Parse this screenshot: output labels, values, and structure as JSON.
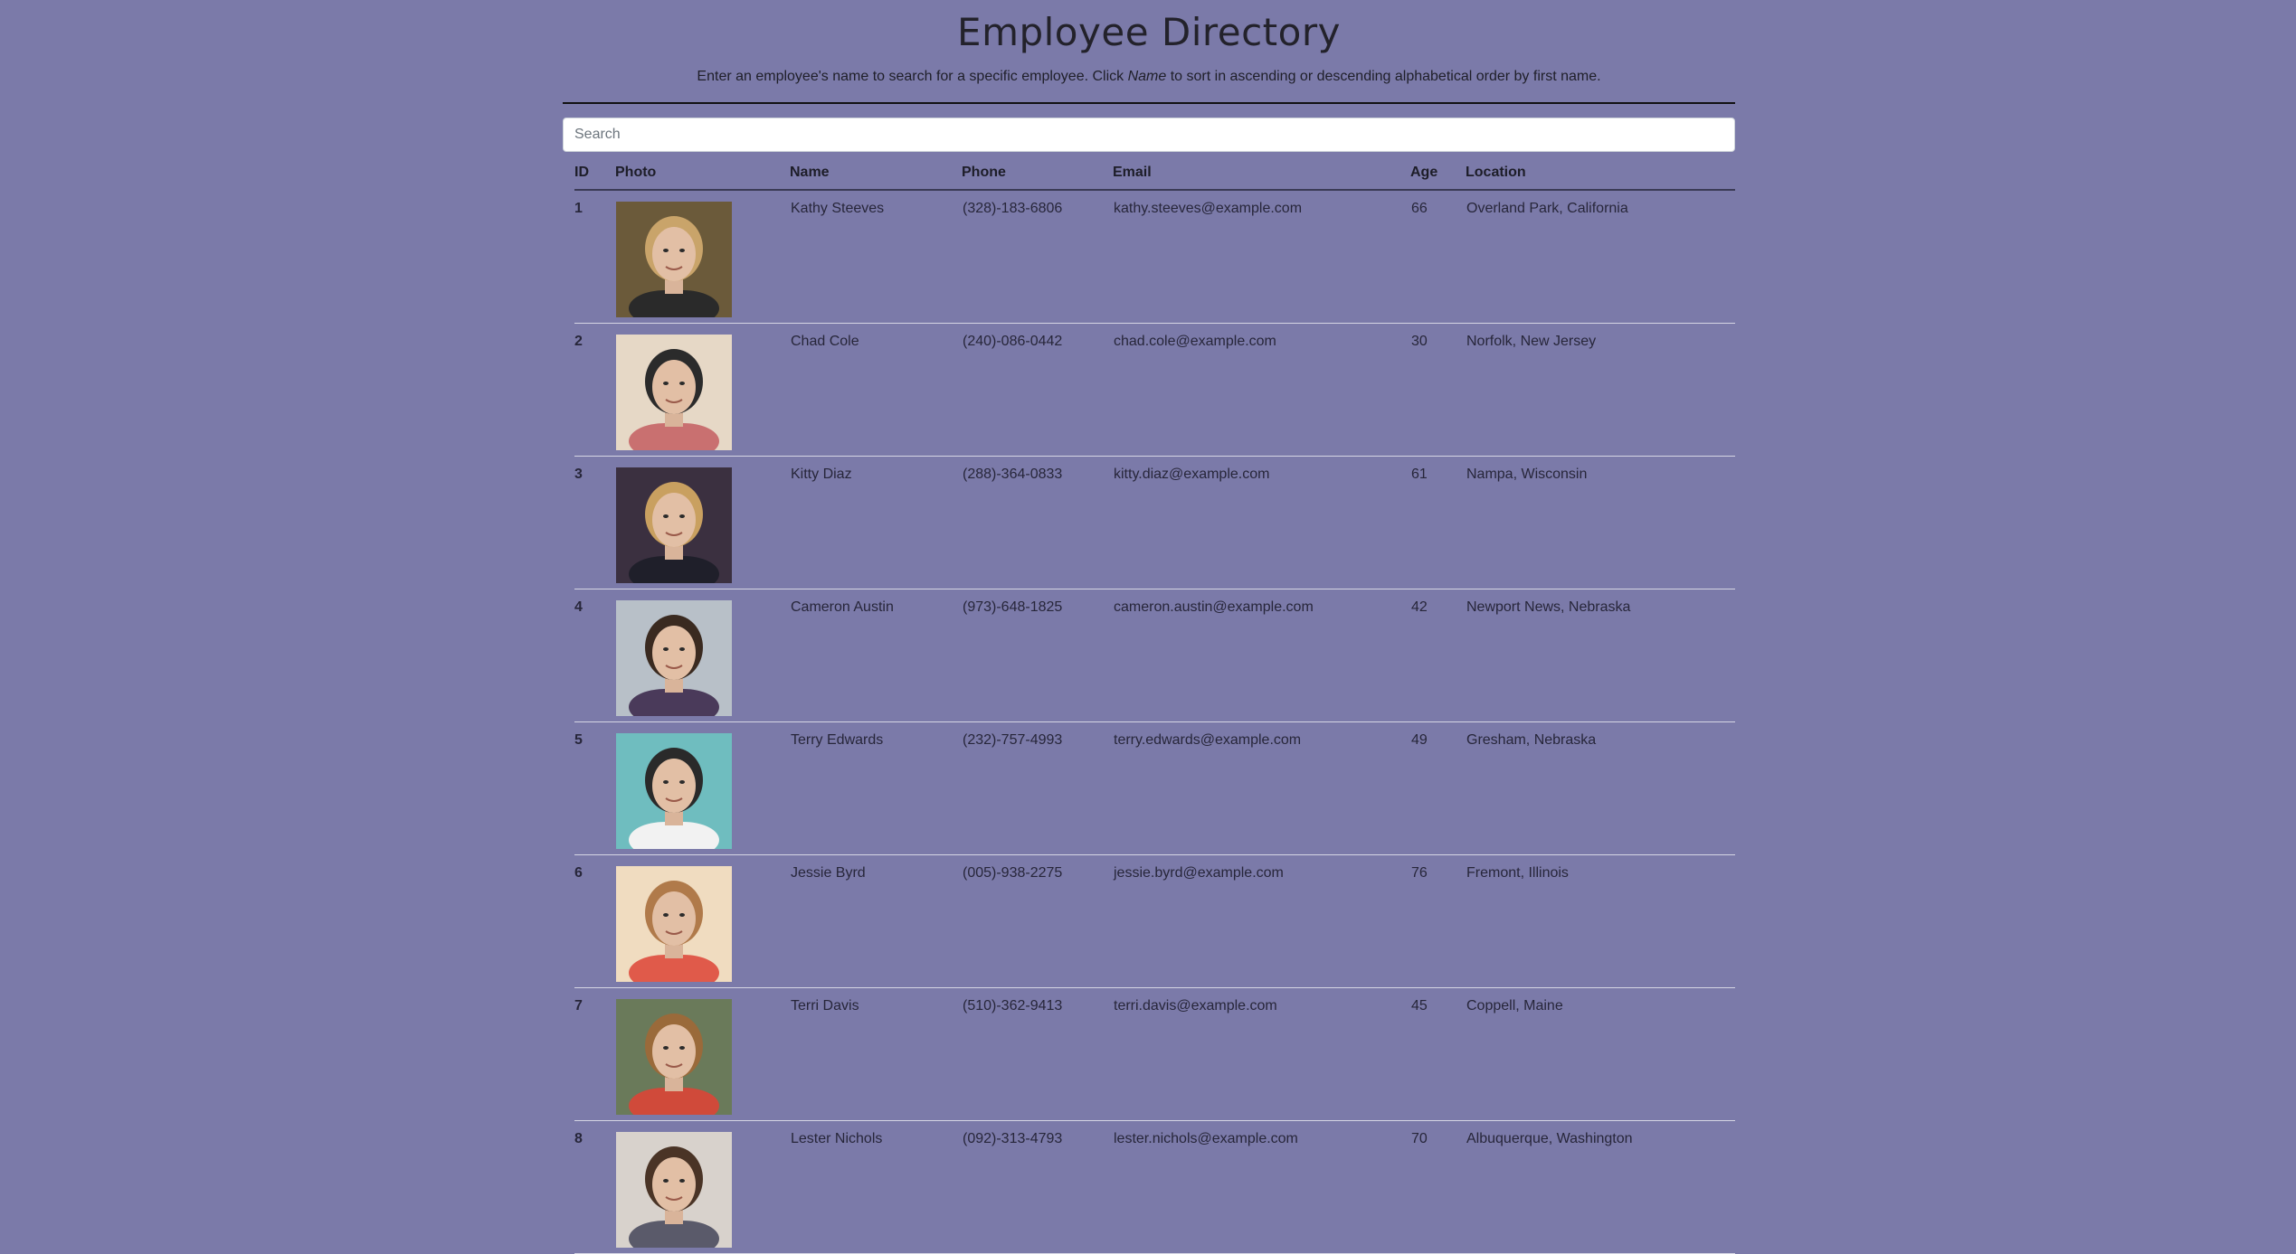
{
  "header": {
    "title": "Employee Directory",
    "subtitle_before": "Enter an employee's name to search for a specific employee. Click ",
    "subtitle_em": "Name",
    "subtitle_after": " to sort in ascending or descending alphabetical order by first name."
  },
  "search": {
    "placeholder": "Search",
    "value": ""
  },
  "table": {
    "columns": [
      "ID",
      "Photo",
      "Name",
      "Phone",
      "Email",
      "Age",
      "Location"
    ],
    "rows": [
      {
        "id": "1",
        "photo_icon": "employee-photo",
        "name": "Kathy Steeves",
        "phone": "(328)-183-6806",
        "email": "kathy.steeves@example.com",
        "age": "66",
        "location": "Overland Park, California"
      },
      {
        "id": "2",
        "photo_icon": "employee-photo",
        "name": "Chad Cole",
        "phone": "(240)-086-0442",
        "email": "chad.cole@example.com",
        "age": "30",
        "location": "Norfolk, New Jersey"
      },
      {
        "id": "3",
        "photo_icon": "employee-photo",
        "name": "Kitty Diaz",
        "phone": "(288)-364-0833",
        "email": "kitty.diaz@example.com",
        "age": "61",
        "location": "Nampa, Wisconsin"
      },
      {
        "id": "4",
        "photo_icon": "employee-photo",
        "name": "Cameron Austin",
        "phone": "(973)-648-1825",
        "email": "cameron.austin@example.com",
        "age": "42",
        "location": "Newport News, Nebraska"
      },
      {
        "id": "5",
        "photo_icon": "employee-photo",
        "name": "Terry Edwards",
        "phone": "(232)-757-4993",
        "email": "terry.edwards@example.com",
        "age": "49",
        "location": "Gresham, Nebraska"
      },
      {
        "id": "6",
        "photo_icon": "employee-photo",
        "name": "Jessie Byrd",
        "phone": "(005)-938-2275",
        "email": "jessie.byrd@example.com",
        "age": "76",
        "location": "Fremont, Illinois"
      },
      {
        "id": "7",
        "photo_icon": "employee-photo",
        "name": "Terri Davis",
        "phone": "(510)-362-9413",
        "email": "terri.davis@example.com",
        "age": "45",
        "location": "Coppell, Maine"
      },
      {
        "id": "8",
        "photo_icon": "employee-photo",
        "name": "Lester Nichols",
        "phone": "(092)-313-4793",
        "email": "lester.nichols@example.com",
        "age": "70",
        "location": "Albuquerque, Washington"
      }
    ]
  },
  "colors": {
    "background": "#7b7aa9",
    "row_divider": "#d6d6e4",
    "search_bg": "#ffffff"
  }
}
